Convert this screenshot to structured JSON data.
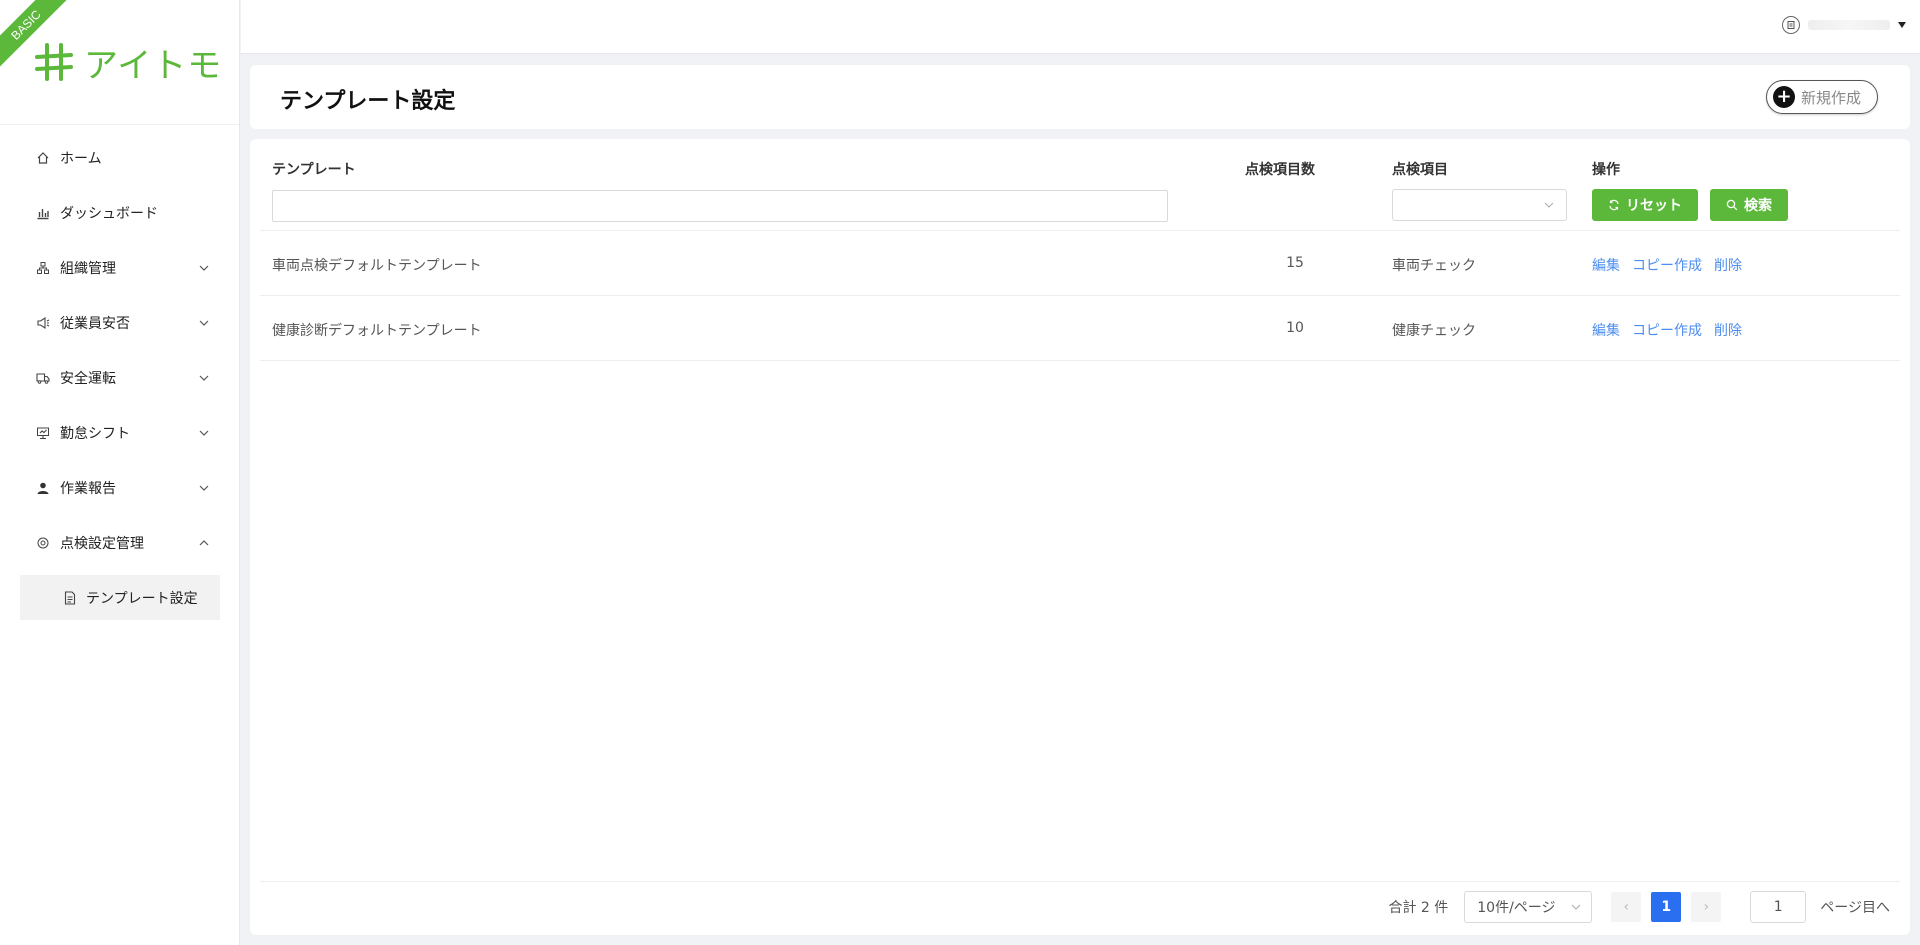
{
  "sidebar": {
    "badge": "BASIC",
    "logo_text": "アイトモ",
    "items": [
      {
        "label": "ホーム",
        "icon": "home-icon"
      },
      {
        "label": "ダッシュボード",
        "icon": "bar-chart-icon"
      },
      {
        "label": "組織管理",
        "icon": "org-icon"
      },
      {
        "label": "従業員安否",
        "icon": "megaphone-icon"
      },
      {
        "label": "安全運転",
        "icon": "truck-icon"
      },
      {
        "label": "勤怠シフト",
        "icon": "monitor-icon"
      },
      {
        "label": "作業報告",
        "icon": "user-icon"
      },
      {
        "label": "点検設定管理",
        "icon": "settings-icon"
      }
    ],
    "sub_item": {
      "label": "テンプレート設定",
      "icon": "file-icon"
    }
  },
  "topbar": {
    "user_icon": "user-badge-icon"
  },
  "page": {
    "title": "テンプレート設定",
    "new_button": "新規作成"
  },
  "filters": {
    "col_template": "テンプレート",
    "col_count": "点検項目数",
    "col_item": "点検項目",
    "col_ops": "操作",
    "template_value": "",
    "item_selected": "",
    "reset_label": "リセット",
    "search_label": "検索"
  },
  "rows": [
    {
      "name": "車両点検デフォルトテンプレート",
      "count": "15",
      "item": "車両チェック",
      "edit": "編集",
      "copy": "コピー作成",
      "delete": "削除"
    },
    {
      "name": "健康診断デフォルトテンプレート",
      "count": "10",
      "item": "健康チェック",
      "edit": "編集",
      "copy": "コピー作成",
      "delete": "削除"
    }
  ],
  "pagination": {
    "total": "合計 2 件",
    "page_size": "10件/ページ",
    "prev": "‹",
    "current": "1",
    "next": "›",
    "jump_value": "1",
    "jump_suffix": "ページ目へ"
  },
  "colors": {
    "brand": "#5cb83b",
    "link": "#4d8ef0",
    "active_page": "#2a6ff0"
  }
}
